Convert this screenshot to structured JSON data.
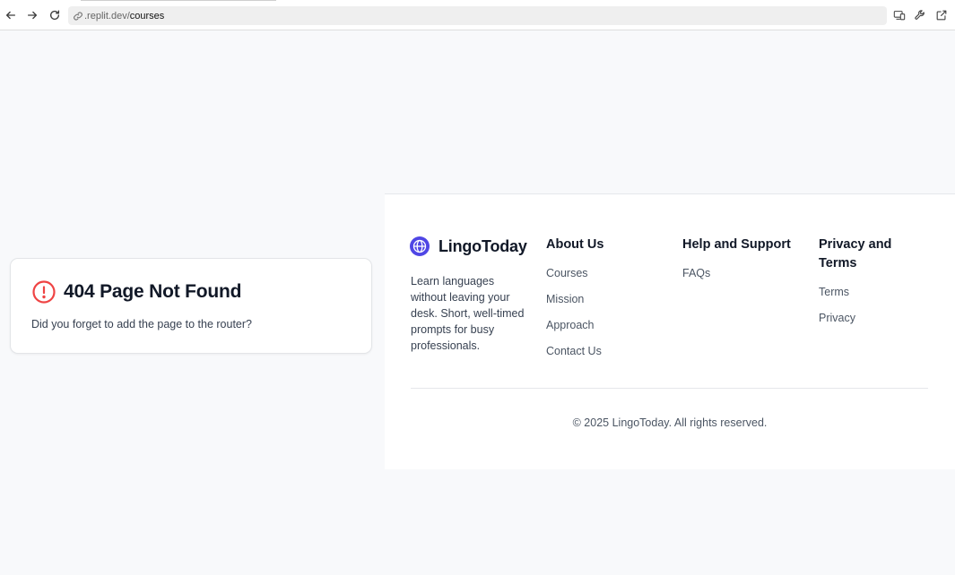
{
  "browser": {
    "url_prefix": ".replit.dev/",
    "url_path": "courses",
    "icons": {
      "back": "arrow-left-icon",
      "forward": "arrow-right-icon",
      "reload": "reload-icon",
      "link": "link-icon",
      "devices": "responsive-devices-icon",
      "devtools": "wrench-icon",
      "open_external": "open-external-icon"
    }
  },
  "not_found": {
    "title": "404 Page Not Found",
    "description": "Did you forget to add the page to the router?",
    "icon": "alert-circle-icon",
    "icon_color": "#ef4444"
  },
  "footer": {
    "brand": {
      "name": "LingoToday",
      "description": "Learn languages without leaving your desk. Short, well-timed prompts for busy professionals.",
      "icon": "globe-icon",
      "color": "#4f46e5"
    },
    "about": {
      "title": "About Us",
      "links": [
        "Courses",
        "Mission",
        "Approach",
        "Contact Us"
      ]
    },
    "help": {
      "title": "Help and Support",
      "links": [
        "FAQs"
      ]
    },
    "privacy": {
      "title": "Privacy and Terms",
      "links": [
        "Terms",
        "Privacy"
      ]
    },
    "copyright": "© 2025 LingoToday. All rights reserved."
  }
}
